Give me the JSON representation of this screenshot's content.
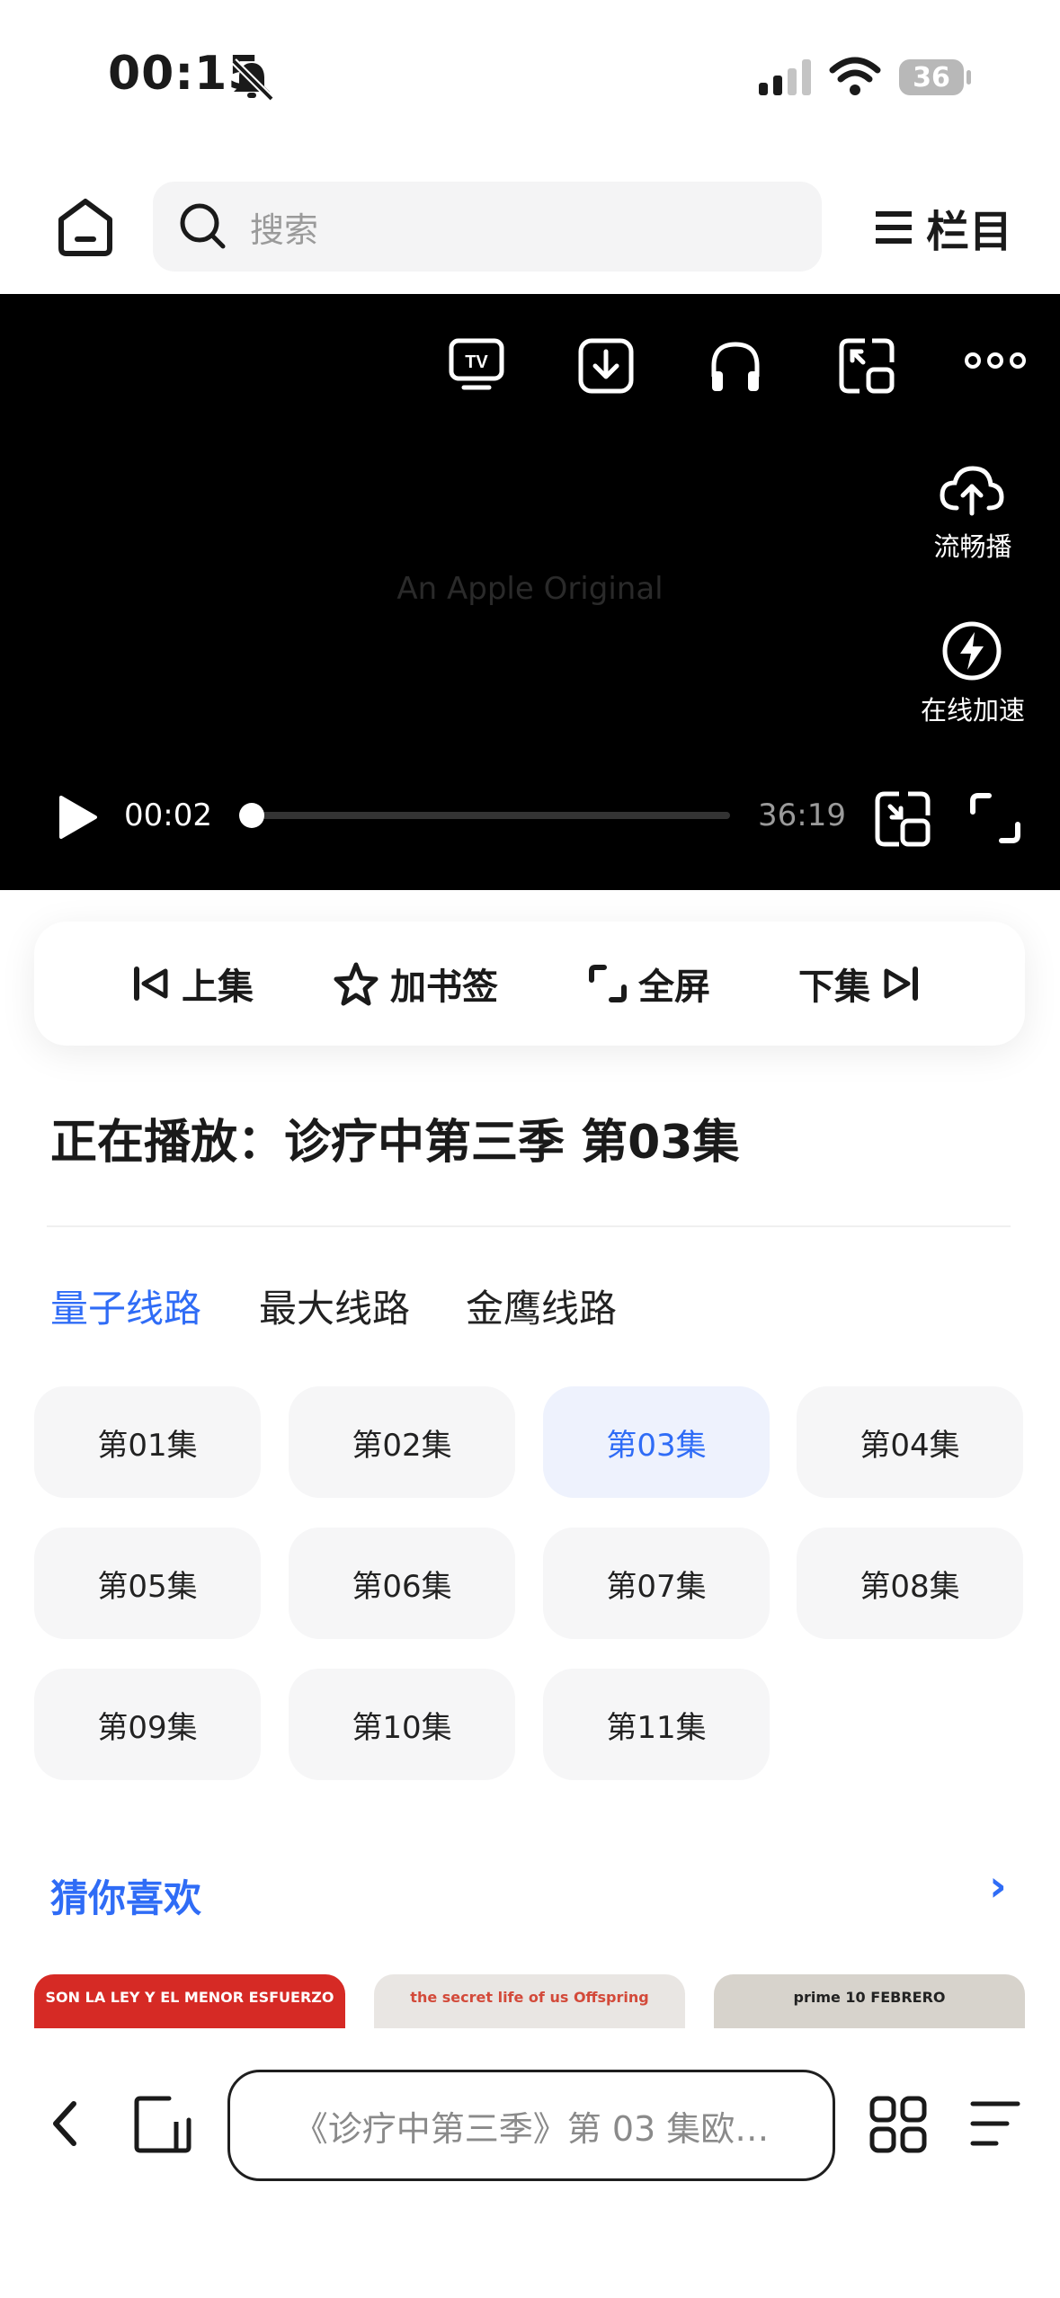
{
  "status_bar": {
    "time": "00:15",
    "battery": "36"
  },
  "header": {
    "search_placeholder": "搜索",
    "columns_label": "栏目"
  },
  "video": {
    "watermark": "An Apple Original",
    "smooth_play_label": "流畅播",
    "online_accel_label": "在线加速",
    "current_time": "00:02",
    "total_time": "36:19",
    "progress_fraction": 0.001
  },
  "controls": {
    "prev": "上集",
    "bookmark": "加书签",
    "fullscreen": "全屏",
    "next": "下集"
  },
  "now_playing": "正在播放：诊疗中第三季 第03集",
  "routes": [
    "量子线路",
    "最大线路",
    "金鹰线路"
  ],
  "active_route": 0,
  "episodes": [
    "第01集",
    "第02集",
    "第03集",
    "第04集",
    "第05集",
    "第06集",
    "第07集",
    "第08集",
    "第09集",
    "第10集",
    "第11集"
  ],
  "active_episode": 2,
  "recommend": {
    "title": "猜你喜欢",
    "more": "›",
    "posters": [
      {
        "text": "SON LA LEY Y EL MENOR ESFUERZO",
        "bg": "#d62a25",
        "fg": "#ffffff"
      },
      {
        "text": "the secret life of us  Offspring",
        "bg": "#e9e6e3",
        "fg": "#d34a3a"
      },
      {
        "text": "prime  10 FEBRERO",
        "bg": "#d7d3cc",
        "fg": "#222222"
      }
    ]
  },
  "bottom_bar": {
    "url_text": "《诊疗中第三季》第 03 集欧…"
  },
  "colors": {
    "accent": "#2f6cf6",
    "active_chip_bg": "#eef2fd",
    "chip_bg": "#f6f6f7"
  }
}
